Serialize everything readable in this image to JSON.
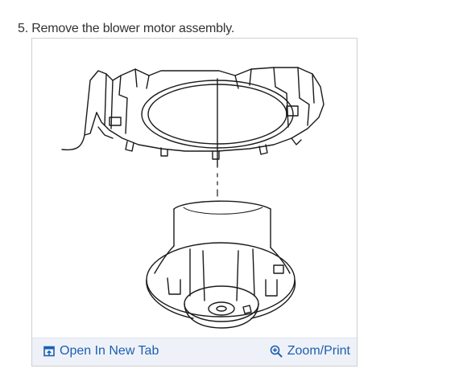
{
  "step": {
    "text": "5. Remove the blower motor assembly."
  },
  "figure": {
    "open_tab": {
      "label": "Open In New Tab",
      "icon": "open-new-tab-icon"
    },
    "zoom_print": {
      "label": "Zoom/Print",
      "icon": "zoom-in-icon"
    }
  },
  "colors": {
    "link": "#1d5fb0",
    "footer_bg": "#eef2f8"
  }
}
